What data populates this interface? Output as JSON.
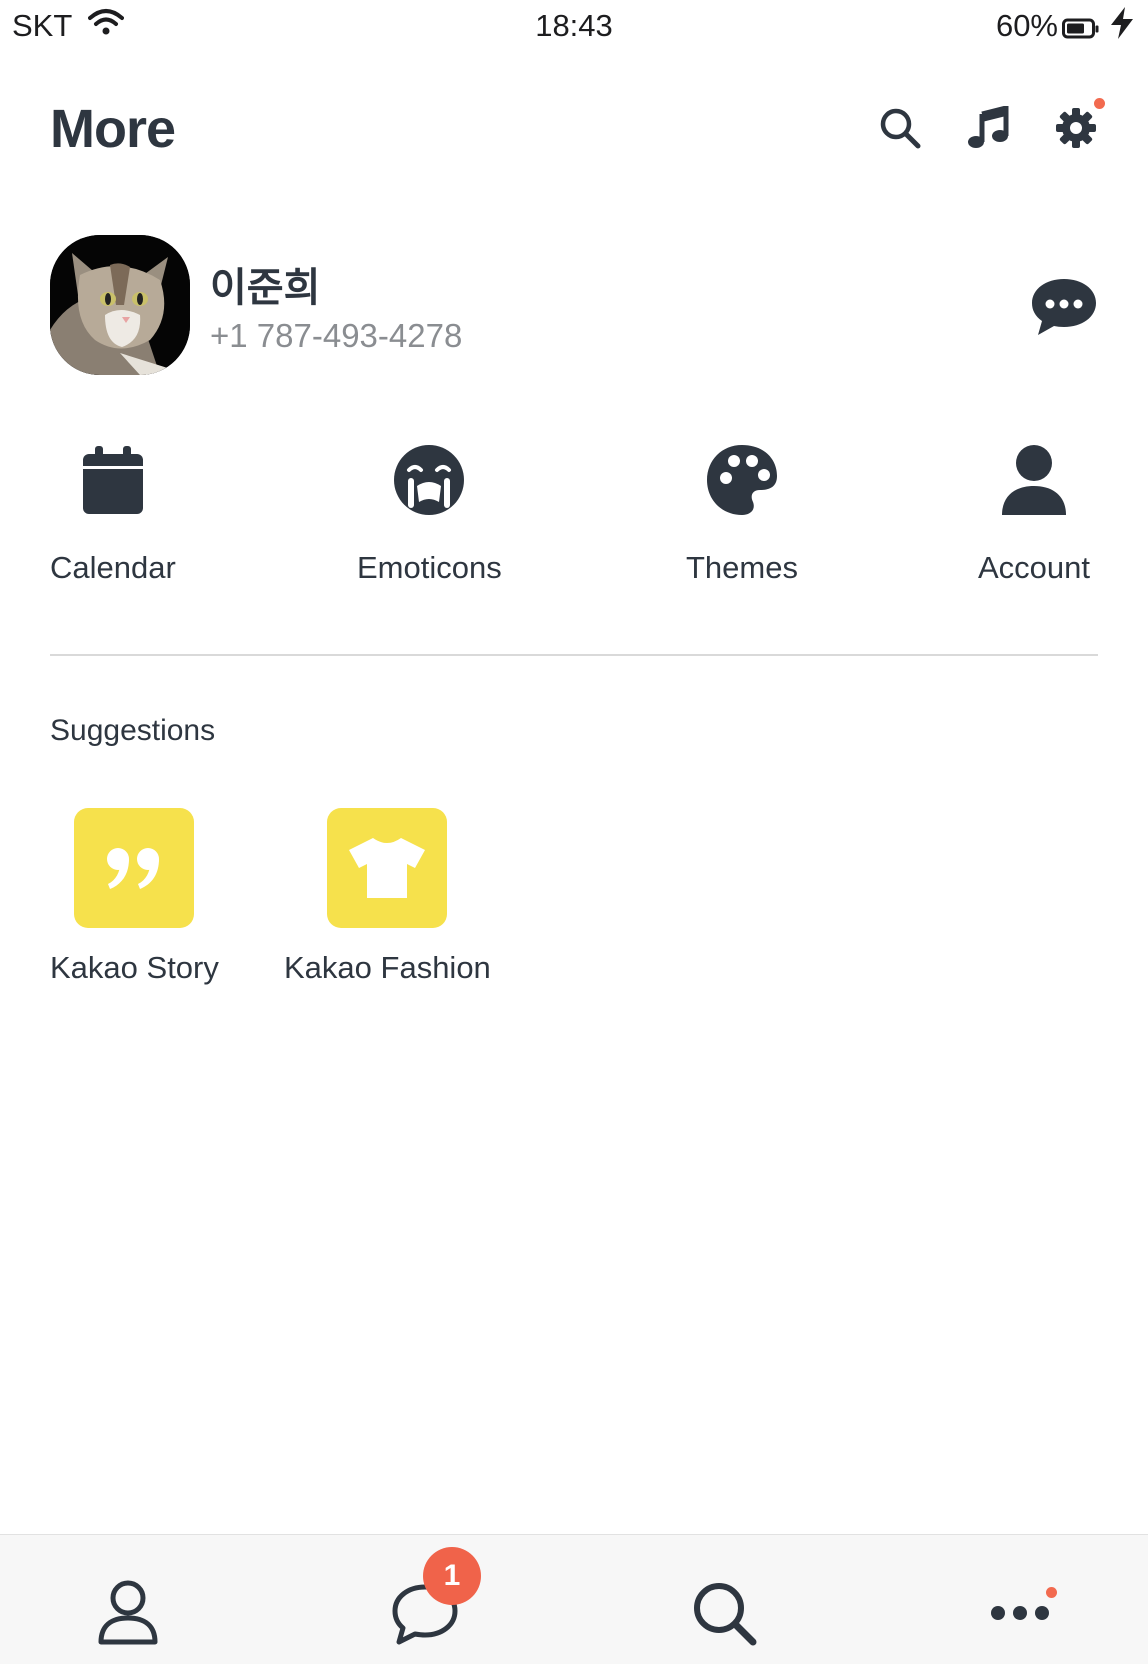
{
  "status_bar": {
    "carrier": "SKT",
    "time": "18:43",
    "battery": "60%"
  },
  "header": {
    "title": "More",
    "icons": [
      "search-icon",
      "music-icon",
      "settings-icon"
    ],
    "settings_has_notification": true
  },
  "profile": {
    "name": "이준희",
    "phone": "+1 787-493-4278"
  },
  "shortcuts": [
    {
      "label": "Calendar",
      "icon": "calendar-icon"
    },
    {
      "label": "Emoticons",
      "icon": "emoticon-icon"
    },
    {
      "label": "Themes",
      "icon": "palette-icon"
    },
    {
      "label": "Account",
      "icon": "person-icon"
    }
  ],
  "suggestions": {
    "title": "Suggestions",
    "items": [
      {
        "label": "Kakao Story",
        "icon": "quote-icon"
      },
      {
        "label": "Kakao Fashion",
        "icon": "tshirt-icon"
      }
    ]
  },
  "tab_bar": {
    "tabs": [
      "friends-tab",
      "chats-tab",
      "search-tab",
      "more-tab"
    ],
    "chats_badge": "1"
  },
  "colors": {
    "accent_yellow": "#f6e14c",
    "badge_red": "#f0634a",
    "icon_dark": "#2e3640"
  }
}
